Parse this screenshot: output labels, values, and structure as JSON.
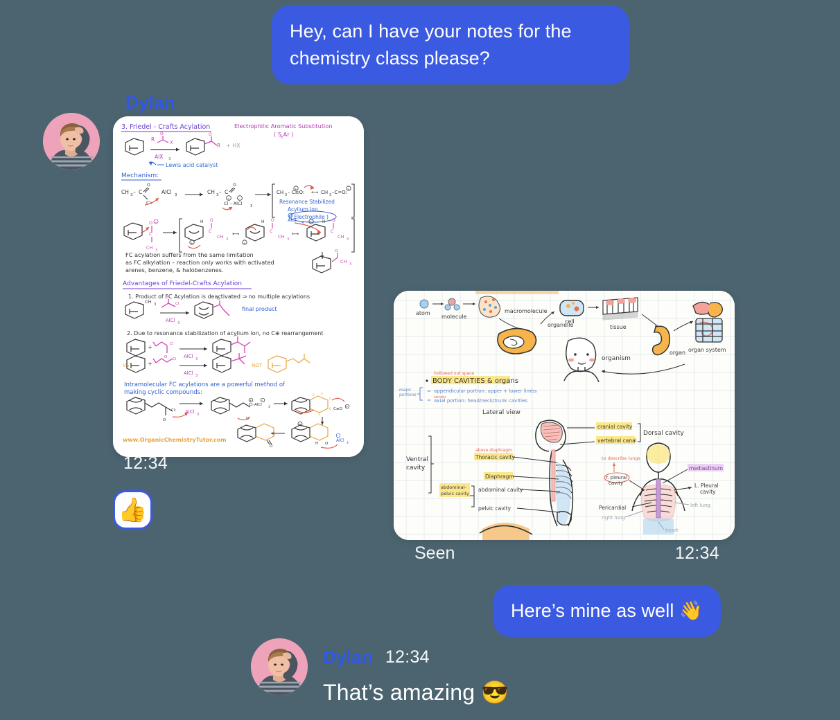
{
  "theme": {
    "background": "#4c6470",
    "bubble_outgoing": "#3b5ae2",
    "sender_name_color": "#2f58e8",
    "text_on_dark": "#f4f7f8",
    "avatar_bg": "#efa3ba",
    "card_bg": "#ffffff"
  },
  "messages": [
    {
      "id": "msg-request",
      "direction": "outgoing",
      "text": "Hey, can I have your notes for the chemistry class please?"
    },
    {
      "id": "msg-chem-note",
      "direction": "incoming",
      "sender": "Dylan",
      "time": "12:34",
      "attachment": "chemistry-notes",
      "reaction": "👍"
    },
    {
      "id": "msg-bio-note",
      "direction": "outgoing",
      "attachment": "biology-notes",
      "status": "Seen",
      "time": "12:34"
    },
    {
      "id": "msg-mine",
      "direction": "outgoing",
      "text": "Here’s mine as well 👋"
    },
    {
      "id": "msg-amazing",
      "direction": "incoming",
      "sender": "Dylan",
      "time": "12:34",
      "text": "That’s amazing 😎"
    }
  ],
  "chemistry_note": {
    "watermark": "www.OrganicChemistryTutor.com",
    "title": "3. Friedel - Crafts  Acylation",
    "subtitle": "Electrophilic Aromatic Substitution",
    "subtitle_sub": "( S  Ar )",
    "subtitle_sub_letter": "E",
    "reagent_top": "R",
    "reagent_x": "X",
    "catalyst": "AlX",
    "catalyst_sub": "3",
    "product_plus": "+ HX",
    "catalyst_note": "Lewis acid  catalyst",
    "mechanism_heading": "Mechanism:",
    "step1_left": "CH",
    "step1_sub": "3",
    "step1_dash": "–  C",
    "step1_cl": "Cl:",
    "step1_alcl3": "AlCl",
    "step1_alcl3_sub": "3",
    "step2_cl_alcl3": "Cl – AlCl",
    "resonance_label_1": "Resonance Stabilized",
    "resonance_label_2": "Acylium Ion",
    "resonance_label_3": "( Electrophile )",
    "resonance_ion_a": "CH   – C≡O:",
    "resonance_ion_b": "CH   – C=O:",
    "alcl4": "AlCl",
    "alcl4_sub": "4",
    "ch3": "CH",
    "h": "H",
    "para_1": "FC acylation suffers from the same limitation",
    "para_2": "as FC alkylation – reaction only works with activated",
    "para_3": "arenes, benzene, & halobenzenes.",
    "advantages_heading": "Advantages of  Friedel-Crafts  Acylation",
    "point_1": "1. Product of FC Acylation is deactivated ⇒ no multiple acylations",
    "point_1_label": "final product",
    "point_2": "2. Due to resonance stabilization of acylium ion, no C⊕ rearrangement",
    "vs_label": "VS",
    "not_label": "NOT",
    "intra_1": "Intramolecular  FC acylations are a  powerful  method of",
    "intra_2": "making cyclic compounds:"
  },
  "biology_note": {
    "hierarchy": [
      "atom",
      "molecule",
      "macromolecule",
      "organelle",
      "cell",
      "tissue",
      "organ",
      "organ system",
      "organism"
    ],
    "section_annotation": "hollowed out space",
    "section_title": "BODY CAVITIES & organs",
    "bracket_label_1": "major",
    "bracket_label_2": "portions",
    "bullet_1": "appendicular portion:  upper + lower  limbs",
    "bullet_2_note": "center",
    "bullet_2": "axial portion: head/neck/trunk cavities",
    "view_label": "Lateral view",
    "labels": {
      "ventral_cavity_1": "Ventral",
      "ventral_cavity_2": "cavity",
      "above_diaphragm": "above diaphragm",
      "thoracic_cavity": "Thoracic cavity",
      "diaphragm": "Diaphragm",
      "abdominal_cavity": "abdominal cavity",
      "abdominal_pelvic_1": "abdominal-",
      "abdominal_pelvic_2": "pelvic cavity",
      "pelvic_cavity": "pelvic cavity",
      "cranial_cavity": "cranial cavity",
      "vertebral_canal": "vertebral canal",
      "dorsal_cavity": "Dorsal cavity",
      "to_describe_lungs": "to describe lungs",
      "r_pleural_1": "r. pleural",
      "r_pleural_2": "cavity",
      "l_pleural_1": "L. Pleural",
      "l_pleural_2": "cavity",
      "mediastinum": "mediastinum",
      "pericardial": "Pericardial",
      "right_lung": "right lung",
      "left_lung": "left lung",
      "heart": "heart"
    }
  }
}
